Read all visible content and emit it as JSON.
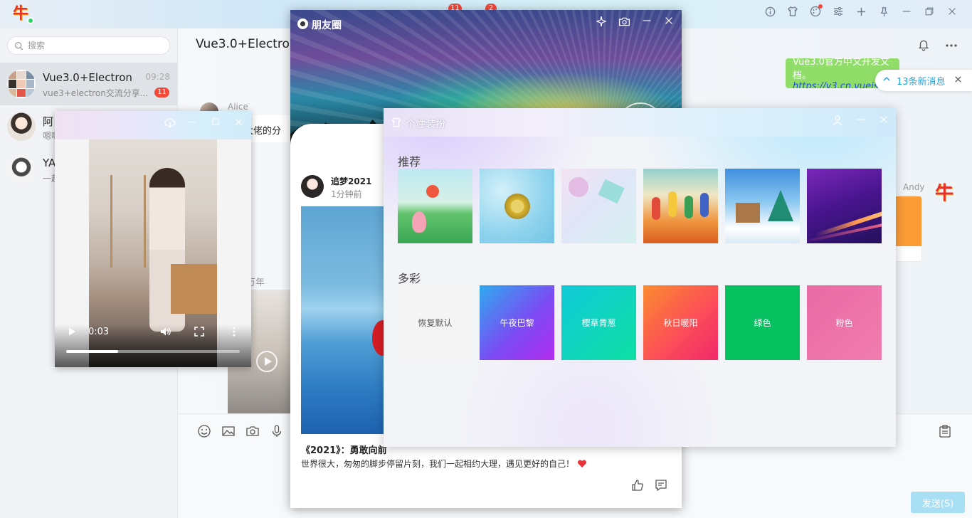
{
  "topbar": {
    "app_logo": "牛",
    "badge_notifications": "11",
    "badge_messages": "2",
    "icons": [
      "info-icon",
      "skin-icon",
      "palette-icon",
      "settings-sliders-icon",
      "plus-icon",
      "pin-icon",
      "minimize-icon",
      "maximize-icon",
      "close-icon"
    ]
  },
  "sidebar": {
    "search_placeholder": "搜索",
    "chats": [
      {
        "name": "Vue3.0+Electron",
        "time": "09:28",
        "preview": "vue3+electron交流分享...",
        "unread": "11"
      },
      {
        "name": "阿",
        "preview": "嗯嗯",
        "time": "",
        "unread": ""
      },
      {
        "name": "YA",
        "preview": "一起",
        "time": "",
        "unread": ""
      }
    ]
  },
  "chat": {
    "title": "Vue3.0+Electron",
    "pinned_text": "Vue3.0官方中文开发文档。",
    "pinned_link": "https://v3.cn.vuejs.org/",
    "new_messages": "13条新消息",
    "alice": "Alice",
    "alice_msg": "附大佬的分",
    "andy": "Andy",
    "video_label": "万年",
    "send_button": "发送(S)"
  },
  "moments": {
    "title": "朋友圈",
    "author": "追梦2021",
    "time": "1分钟前",
    "post_title": "《2021》：勇敢向前",
    "post_body": "世界很大，匆匆的脚步停留片刻，我们一起相约大理，遇见更好的自己！"
  },
  "skin": {
    "title": "个性装扮",
    "section_recommend": "推荐",
    "section_colorful": "多彩",
    "colors": [
      {
        "label": "恢复默认",
        "color": "#f4f4f4"
      },
      {
        "label": "午夜巴黎",
        "color": "#6a4cf5"
      },
      {
        "label": "樱草青葱",
        "color": "#11d4c2"
      },
      {
        "label": "秋日暖阳",
        "color": "#fb5a4c"
      },
      {
        "label": "绿色",
        "color": "#07c160"
      },
      {
        "label": "粉色",
        "color": "#ec6fa6"
      }
    ]
  },
  "video": {
    "current_time": "0:03",
    "progress": 0.3
  }
}
